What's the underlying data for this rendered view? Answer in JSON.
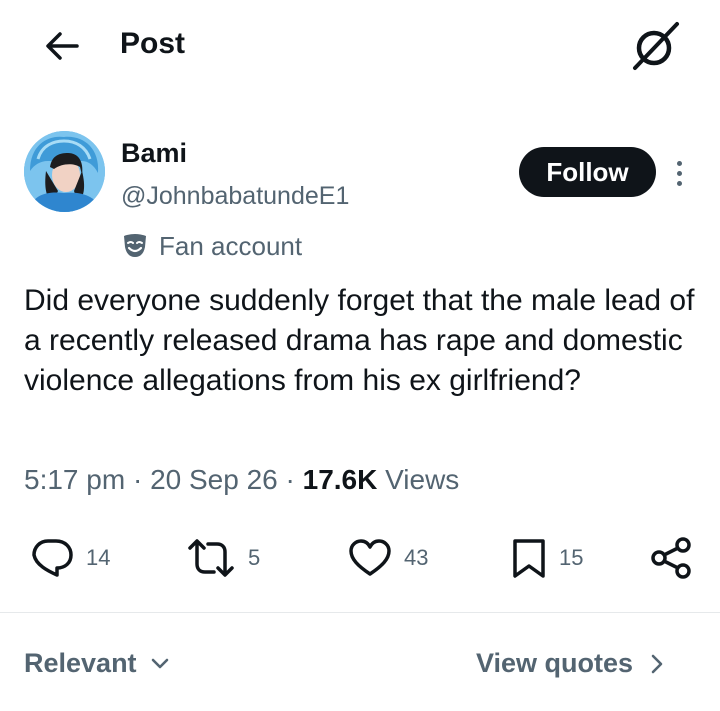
{
  "header": {
    "title": "Post",
    "back_icon": "arrow-left-icon",
    "grok_icon": "grok-icon"
  },
  "author": {
    "name": "Bami",
    "handle": "@JohnbabatundeE1",
    "avatar_icon": "user-avatar"
  },
  "follow_button": {
    "label": "Follow"
  },
  "label": {
    "icon": "mask-icon",
    "text": "Fan account"
  },
  "tweet": {
    "text": "Did everyone suddenly forget that the male lead of a recently released drama has rape and domestic violence allegations from his ex girlfriend?"
  },
  "meta": {
    "time": "5:17 pm",
    "separator": "·",
    "date": "20 Sep 26",
    "views_count": "17.6K",
    "views_label": "Views"
  },
  "actions": {
    "replies": {
      "icon": "reply-icon",
      "count": "14"
    },
    "reposts": {
      "icon": "repost-icon",
      "count": "5"
    },
    "likes": {
      "icon": "heart-icon",
      "count": "43"
    },
    "bookmarks": {
      "icon": "bookmark-icon",
      "count": "15"
    },
    "share": {
      "icon": "share-icon"
    }
  },
  "footer": {
    "sort_label": "Relevant",
    "view_quotes_label": "View quotes"
  },
  "colors": {
    "text_primary": "#0f1419",
    "text_secondary": "#536471",
    "follow_bg": "#0f1419",
    "divider": "#e6e9eb"
  }
}
